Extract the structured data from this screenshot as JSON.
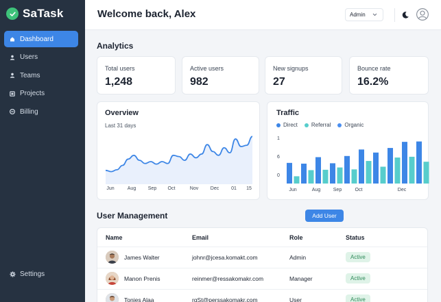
{
  "app": {
    "name": "SaTask"
  },
  "sidebar": {
    "items": [
      {
        "label": "Dashboard",
        "icon": "home-icon",
        "active": true
      },
      {
        "label": "Users",
        "icon": "user-icon",
        "active": false
      },
      {
        "label": "Teams",
        "icon": "team-icon",
        "active": false
      },
      {
        "label": "Projects",
        "icon": "folder-icon",
        "active": false
      },
      {
        "label": "Billing",
        "icon": "billing-icon",
        "active": false
      }
    ],
    "settings_label": "Settings"
  },
  "header": {
    "welcome": "Welcome back, Alex",
    "role": "Admin"
  },
  "analytics": {
    "title": "Analytics",
    "stats": [
      {
        "label": "Total users",
        "value": "1,248"
      },
      {
        "label": "Active users",
        "value": "982"
      },
      {
        "label": "New signups",
        "value": "27"
      },
      {
        "label": "Bounce rate",
        "value": "16.2%"
      }
    ]
  },
  "overview": {
    "title": "Overview",
    "subtitle": "Last 31 days"
  },
  "traffic": {
    "title": "Traffic"
  },
  "chart_data": [
    {
      "type": "area",
      "title": "Overview",
      "subtitle": "Last 31 days",
      "x_labels": [
        "Jun",
        "Aug",
        "Sep",
        "Oct",
        "Nov",
        "Dec",
        "01",
        "15"
      ],
      "values": [
        22,
        20,
        23,
        30,
        40,
        46,
        38,
        33,
        36,
        32,
        36,
        33,
        46,
        44,
        38,
        48,
        42,
        48,
        63,
        52,
        46,
        58,
        50,
        72,
        60,
        62,
        76
      ],
      "color": "#3d86e6",
      "fill": "#e9f0fc"
    },
    {
      "type": "bar",
      "title": "Traffic",
      "categories": [
        "Jun",
        "Aug",
        "Sep",
        "Oct",
        "Dec"
      ],
      "y_ticks": [
        "1",
        "6",
        "0"
      ],
      "legend_position": "top",
      "series": [
        {
          "name": "Direct",
          "color": "#3d86e6"
        },
        {
          "name": "Referral",
          "color": "#57cdcc"
        },
        {
          "name": "Organic",
          "color": "#4b8ff0"
        }
      ],
      "bars": [
        {
          "series": 0,
          "value": 5.4
        },
        {
          "series": 1,
          "value": 1.9
        },
        {
          "series": 0,
          "value": 5.2
        },
        {
          "series": 1,
          "value": 3.5
        },
        {
          "series": 0,
          "value": 6.9
        },
        {
          "series": 1,
          "value": 3.6
        },
        {
          "series": 0,
          "value": 5.3
        },
        {
          "series": 1,
          "value": 4.2
        },
        {
          "series": 0,
          "value": 7.2
        },
        {
          "series": 1,
          "value": 3.7
        },
        {
          "series": 0,
          "value": 8.9
        },
        {
          "series": 1,
          "value": 5.9
        },
        {
          "series": 0,
          "value": 8.1
        },
        {
          "series": 1,
          "value": 4.4
        },
        {
          "series": 0,
          "value": 9.3
        },
        {
          "series": 1,
          "value": 6.8
        },
        {
          "series": 0,
          "value": 10.9
        },
        {
          "series": 1,
          "value": 7.0
        },
        {
          "series": 0,
          "value": 11.0
        },
        {
          "series": 1,
          "value": 5.7
        },
        {
          "series": 0,
          "value": 10.8
        }
      ],
      "ylim": [
        0,
        12
      ]
    }
  ],
  "user_management": {
    "title": "User Management",
    "add_label": "Add User",
    "columns": [
      "Name",
      "Email",
      "Role",
      "Status"
    ],
    "rows": [
      {
        "name": "James Walter",
        "email": "johnr@jcesa.komakt.com",
        "role": "Admin",
        "status": "Active"
      },
      {
        "name": "Manon Prenis",
        "email": "reinmer@ressakomakr.com",
        "role": "Manager",
        "status": "Active"
      },
      {
        "name": "Tonies Alaa",
        "email": "rgSt@perssakomakr.com",
        "role": "User",
        "status": "Active"
      }
    ]
  }
}
